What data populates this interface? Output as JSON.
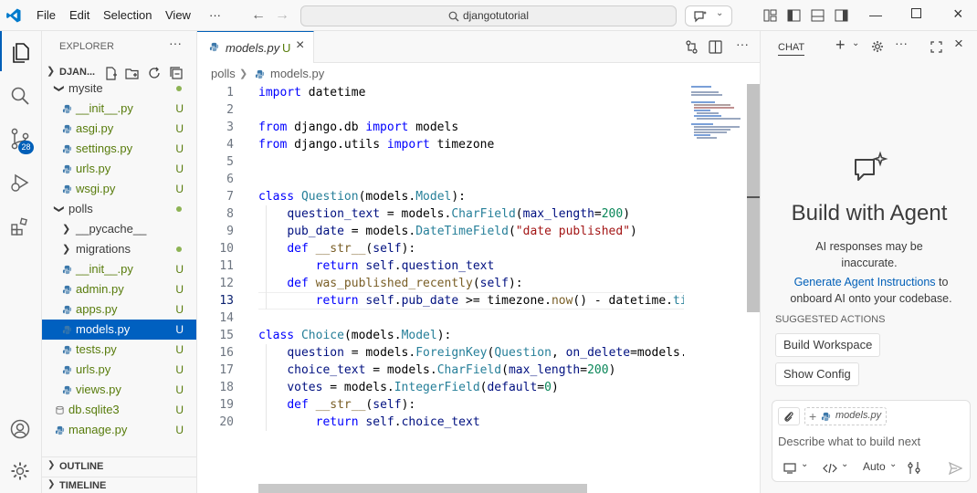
{
  "titlebar": {
    "menu": [
      "File",
      "Edit",
      "Selection",
      "View",
      "···"
    ],
    "search": "djangotutorial"
  },
  "activity": {
    "scm_badge": "28"
  },
  "explorer": {
    "title": "EXPLORER",
    "root": "DJAN...",
    "items": [
      {
        "label": "mysite",
        "kind": "folder",
        "status": "dot"
      },
      {
        "label": "__init__.py",
        "kind": "py",
        "status": "U"
      },
      {
        "label": "asgi.py",
        "kind": "py",
        "status": "U"
      },
      {
        "label": "settings.py",
        "kind": "py",
        "status": "U"
      },
      {
        "label": "urls.py",
        "kind": "py",
        "status": "U"
      },
      {
        "label": "wsgi.py",
        "kind": "py",
        "status": "U"
      },
      {
        "label": "polls",
        "kind": "folder",
        "status": "dot"
      },
      {
        "label": "__pycache__",
        "kind": "folder-collapsed",
        "status": ""
      },
      {
        "label": "migrations",
        "kind": "folder-collapsed",
        "status": "dot"
      },
      {
        "label": "__init__.py",
        "kind": "py",
        "status": "U"
      },
      {
        "label": "admin.py",
        "kind": "py",
        "status": "U"
      },
      {
        "label": "apps.py",
        "kind": "py",
        "status": "U"
      },
      {
        "label": "models.py",
        "kind": "py",
        "status": "U"
      },
      {
        "label": "tests.py",
        "kind": "py",
        "status": "U"
      },
      {
        "label": "urls.py",
        "kind": "py",
        "status": "U"
      },
      {
        "label": "views.py",
        "kind": "py",
        "status": "U"
      },
      {
        "label": "db.sqlite3",
        "kind": "db",
        "status": "U"
      },
      {
        "label": "manage.py",
        "kind": "py",
        "status": "U"
      }
    ],
    "outline": "OUTLINE",
    "timeline": "TIMELINE"
  },
  "editor": {
    "tab_label": "models.py",
    "tab_status": "U",
    "breadcrumb": [
      "polls",
      "models.py"
    ],
    "line_numbers": [
      "1",
      "2",
      "3",
      "4",
      "5",
      "6",
      "7",
      "8",
      "9",
      "10",
      "11",
      "12",
      "13",
      "14",
      "15",
      "16",
      "17",
      "18",
      "19",
      "20"
    ],
    "current_line": "13"
  },
  "chat": {
    "header": "CHAT",
    "title": "Build with Agent",
    "disclaimer": "AI responses may be inaccurate.",
    "link_text": "Generate Agent Instructions",
    "link_suffix": " to onboard AI onto your codebase.",
    "suggested_label": "SUGGESTED ACTIONS",
    "actions": [
      "Build Workspace",
      "Show Config"
    ],
    "context_file": "models.py",
    "input_placeholder": "Describe what to build next",
    "mode": "Auto"
  },
  "colors": {
    "accent": "#005fb8",
    "selection": "#0060c0",
    "untracked": "#587c0c"
  }
}
